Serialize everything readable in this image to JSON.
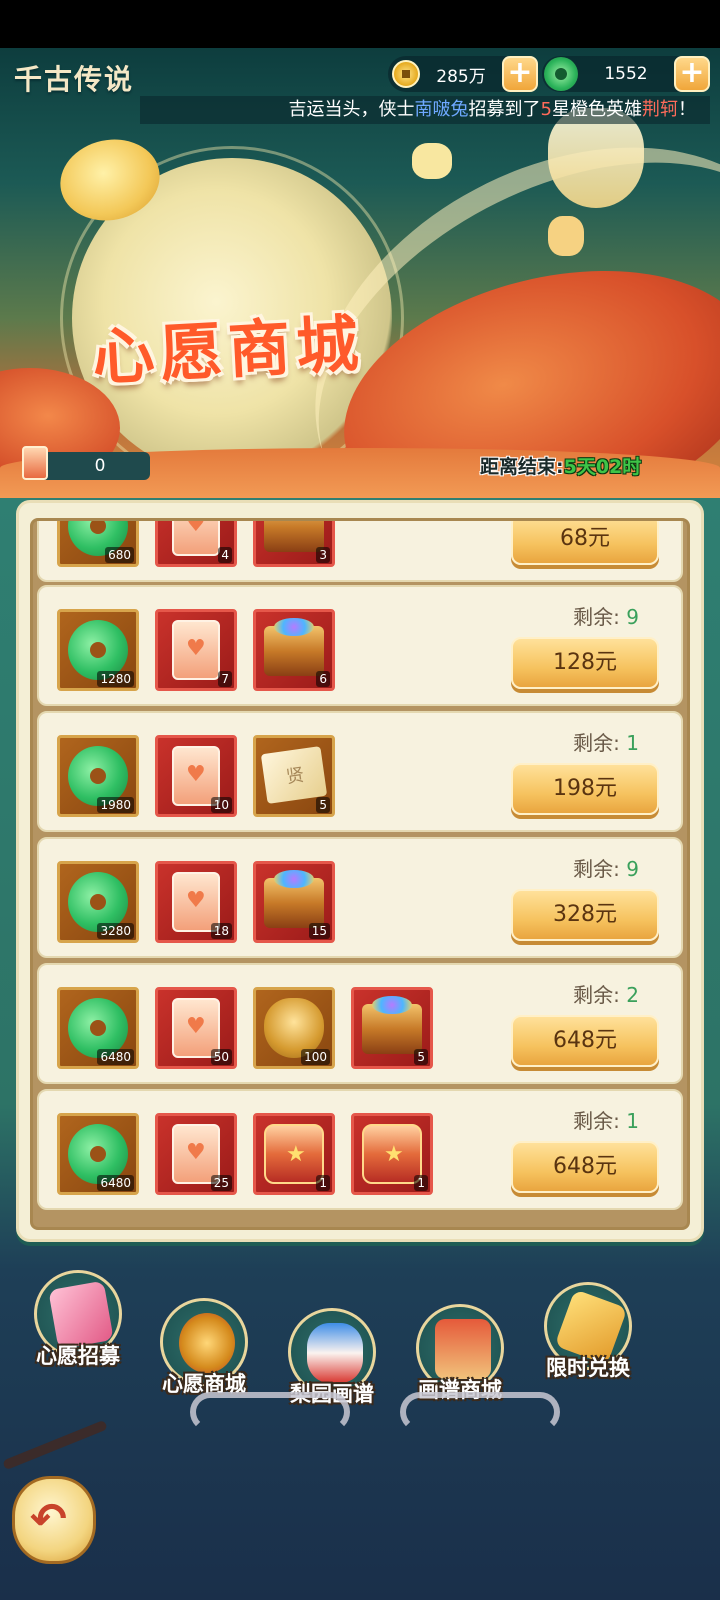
{
  "header": {
    "game_title": "千古传说",
    "currencies": [
      {
        "name": "coins",
        "value": "285万"
      },
      {
        "name": "jade",
        "value": "1552"
      }
    ],
    "plus_label": "+",
    "ticker": {
      "prefix": "吉运当头，侠士",
      "player": "南啵兔",
      "middle": "招募到了",
      "star": "5",
      "suffix": "星橙色英雄",
      "hero": "荆轲",
      "end": "！"
    }
  },
  "banner": {
    "title": "心愿商城",
    "ticket_count": "0",
    "countdown_label": "距离结束:",
    "countdown_value": "5天02时"
  },
  "shop": {
    "remaining_label": "剩余:",
    "rows": [
      {
        "items": [
          {
            "icon": "jade-icon",
            "count": "680"
          },
          {
            "icon": "wish-scroll-icon",
            "count": "4"
          },
          {
            "icon": "treasure-chest-icon",
            "count": "3"
          }
        ],
        "remaining": "",
        "price": "68元"
      },
      {
        "items": [
          {
            "icon": "jade-icon",
            "count": "1280"
          },
          {
            "icon": "wish-scroll-icon",
            "count": "7"
          },
          {
            "icon": "treasure-chest-icon",
            "count": "6"
          }
        ],
        "remaining": "9",
        "price": "128元"
      },
      {
        "items": [
          {
            "icon": "jade-icon",
            "count": "1980"
          },
          {
            "icon": "wish-scroll-icon",
            "count": "10"
          },
          {
            "icon": "sage-scroll-icon",
            "count": "5"
          }
        ],
        "remaining": "1",
        "price": "198元"
      },
      {
        "items": [
          {
            "icon": "jade-icon",
            "count": "3280"
          },
          {
            "icon": "wish-scroll-icon",
            "count": "18"
          },
          {
            "icon": "treasure-chest-icon",
            "count": "15"
          }
        ],
        "remaining": "9",
        "price": "328元"
      },
      {
        "items": [
          {
            "icon": "jade-icon",
            "count": "6480"
          },
          {
            "icon": "wish-scroll-icon",
            "count": "50"
          },
          {
            "icon": "golden-mask-icon",
            "count": "100"
          },
          {
            "icon": "treasure-chest-icon",
            "count": "5"
          }
        ],
        "remaining": "2",
        "price": "648元"
      },
      {
        "items": [
          {
            "icon": "jade-icon",
            "count": "6480"
          },
          {
            "icon": "wish-scroll-icon",
            "count": "25"
          },
          {
            "icon": "hero-chest-icon",
            "count": "1"
          },
          {
            "icon": "red-chest-icon",
            "count": "1"
          }
        ],
        "remaining": "1",
        "price": "648元"
      }
    ]
  },
  "nav": [
    {
      "label": "心愿招募",
      "icon": "wish-recruit-icon"
    },
    {
      "label": "心愿商城",
      "icon": "wish-shop-icon"
    },
    {
      "label": "梨园画谱",
      "icon": "opera-mask-icon"
    },
    {
      "label": "画谱商城",
      "icon": "gallery-shop-icon"
    },
    {
      "label": "限时兑换",
      "icon": "exchange-icon"
    }
  ],
  "back_icon": "back-arrow-icon"
}
